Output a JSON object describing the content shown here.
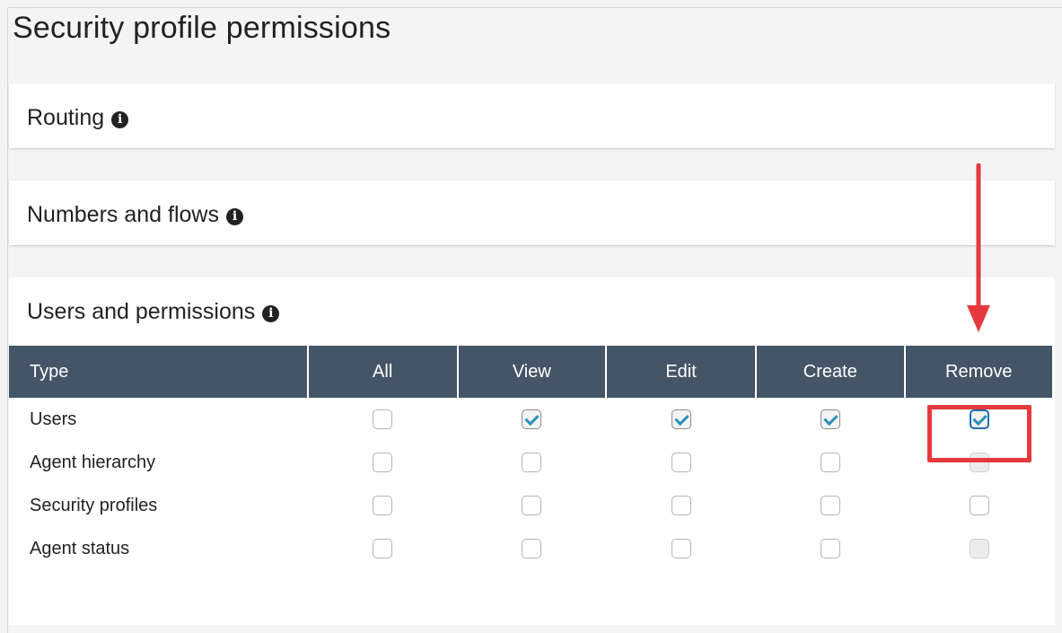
{
  "page": {
    "title": "Security profile permissions"
  },
  "sections": {
    "routing": {
      "label": "Routing"
    },
    "numbers": {
      "label": "Numbers and flows"
    },
    "users": {
      "label": "Users and permissions"
    }
  },
  "table": {
    "headers": {
      "type": "Type",
      "all": "All",
      "view": "View",
      "edit": "Edit",
      "create": "Create",
      "remove": "Remove"
    },
    "rows": [
      {
        "type": "Users",
        "all": "unchecked",
        "view": "checked",
        "edit": "checked",
        "create": "checked",
        "remove": "checked"
      },
      {
        "type": "Agent hierarchy",
        "all": "unchecked",
        "view": "unchecked",
        "edit": "unchecked",
        "create": "unchecked",
        "remove": "disabled"
      },
      {
        "type": "Security profiles",
        "all": "unchecked",
        "view": "unchecked",
        "edit": "unchecked",
        "create": "unchecked",
        "remove": "unchecked"
      },
      {
        "type": "Agent status",
        "all": "unchecked",
        "view": "unchecked",
        "edit": "unchecked",
        "create": "unchecked",
        "remove": "disabled"
      }
    ]
  },
  "colors": {
    "header_bg": "#455568",
    "check_color": "#2a8fb8",
    "annotation_red": "#e5393f"
  }
}
